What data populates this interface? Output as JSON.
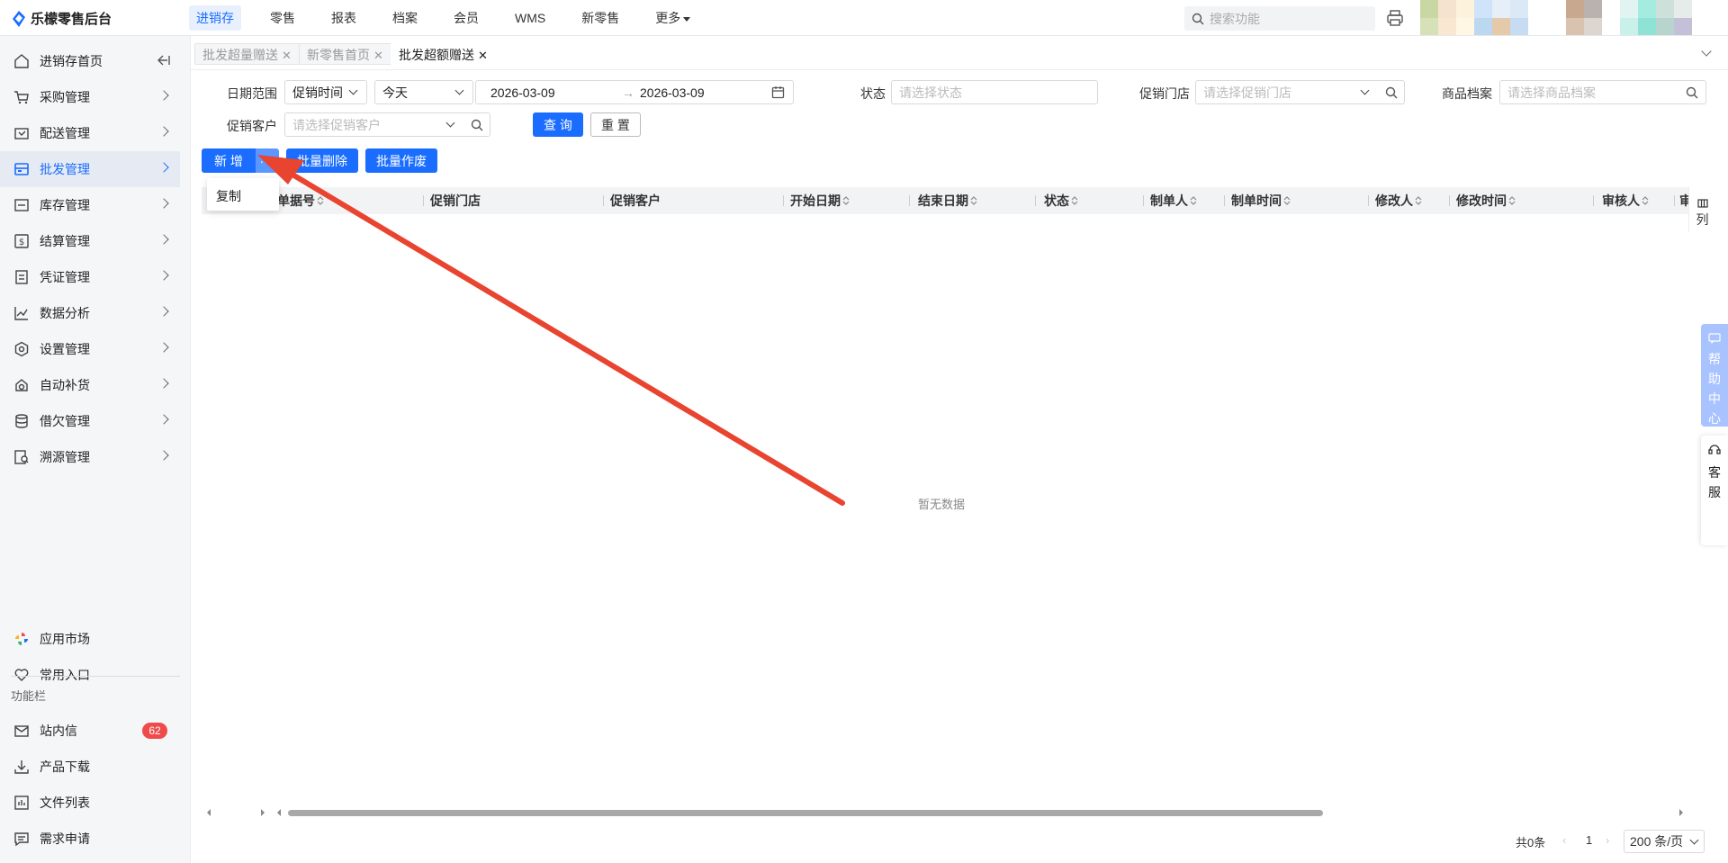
{
  "app": {
    "title": "乐檬零售后台"
  },
  "topnav": {
    "items": [
      "进销存",
      "零售",
      "报表",
      "档案",
      "会员",
      "WMS",
      "新零售",
      "更多"
    ],
    "active_index": 0
  },
  "search": {
    "placeholder": "搜索功能"
  },
  "sidebar": {
    "items": [
      "进销存首页",
      "采购管理",
      "配送管理",
      "批发管理",
      "库存管理",
      "结算管理",
      "凭证管理",
      "数据分析",
      "设置管理",
      "自动补货",
      "借欠管理",
      "溯源管理"
    ],
    "active_index": 3,
    "bottom_items": [
      "应用市场",
      "常用入口"
    ],
    "section_label": "功能栏",
    "func_items": [
      "站内信",
      "产品下载",
      "文件列表",
      "需求申请"
    ],
    "message_badge": "62"
  },
  "tabs": [
    {
      "label": "批发超量赠送",
      "active": false
    },
    {
      "label": "新零售首页",
      "active": false
    },
    {
      "label": "批发超额赠送",
      "active": true
    }
  ],
  "filters": {
    "date_range_label": "日期范围",
    "date_type": "促销时间",
    "date_preset": "今天",
    "date_start": "2026-03-09",
    "date_end": "2026-03-09",
    "date_sep": "→",
    "status_label": "状态",
    "status_placeholder": "请选择状态",
    "store_label": "促销门店",
    "store_placeholder": "请选择促销门店",
    "product_label": "商品档案",
    "product_placeholder": "请选择商品档案",
    "customer_label": "促销客户",
    "customer_placeholder": "请选择促销客户",
    "query_button": "查 询",
    "reset_button": "重 置"
  },
  "toolbar": {
    "add_button": "新 增",
    "more_button": "···",
    "batch_delete_button": "批量删除",
    "batch_void_button": "批量作废",
    "dropdown_items": [
      "复制"
    ]
  },
  "table": {
    "columns": [
      "单据号",
      "促销门店",
      "促销客户",
      "开始日期",
      "结束日期",
      "状态",
      "制单人",
      "制单时间",
      "修改人",
      "修改时间",
      "审核人",
      "审"
    ],
    "empty_text": "暂无数据",
    "column_setting": "列"
  },
  "pagination": {
    "total": "共0条",
    "current_page": "1",
    "page_size": "200 条/页"
  },
  "float": {
    "help": "帮助中心",
    "service": "客服"
  },
  "colors": {
    "accent": "#1a6dff",
    "badge": "#f04b4b",
    "annotation_arrow": "#e8442f"
  }
}
